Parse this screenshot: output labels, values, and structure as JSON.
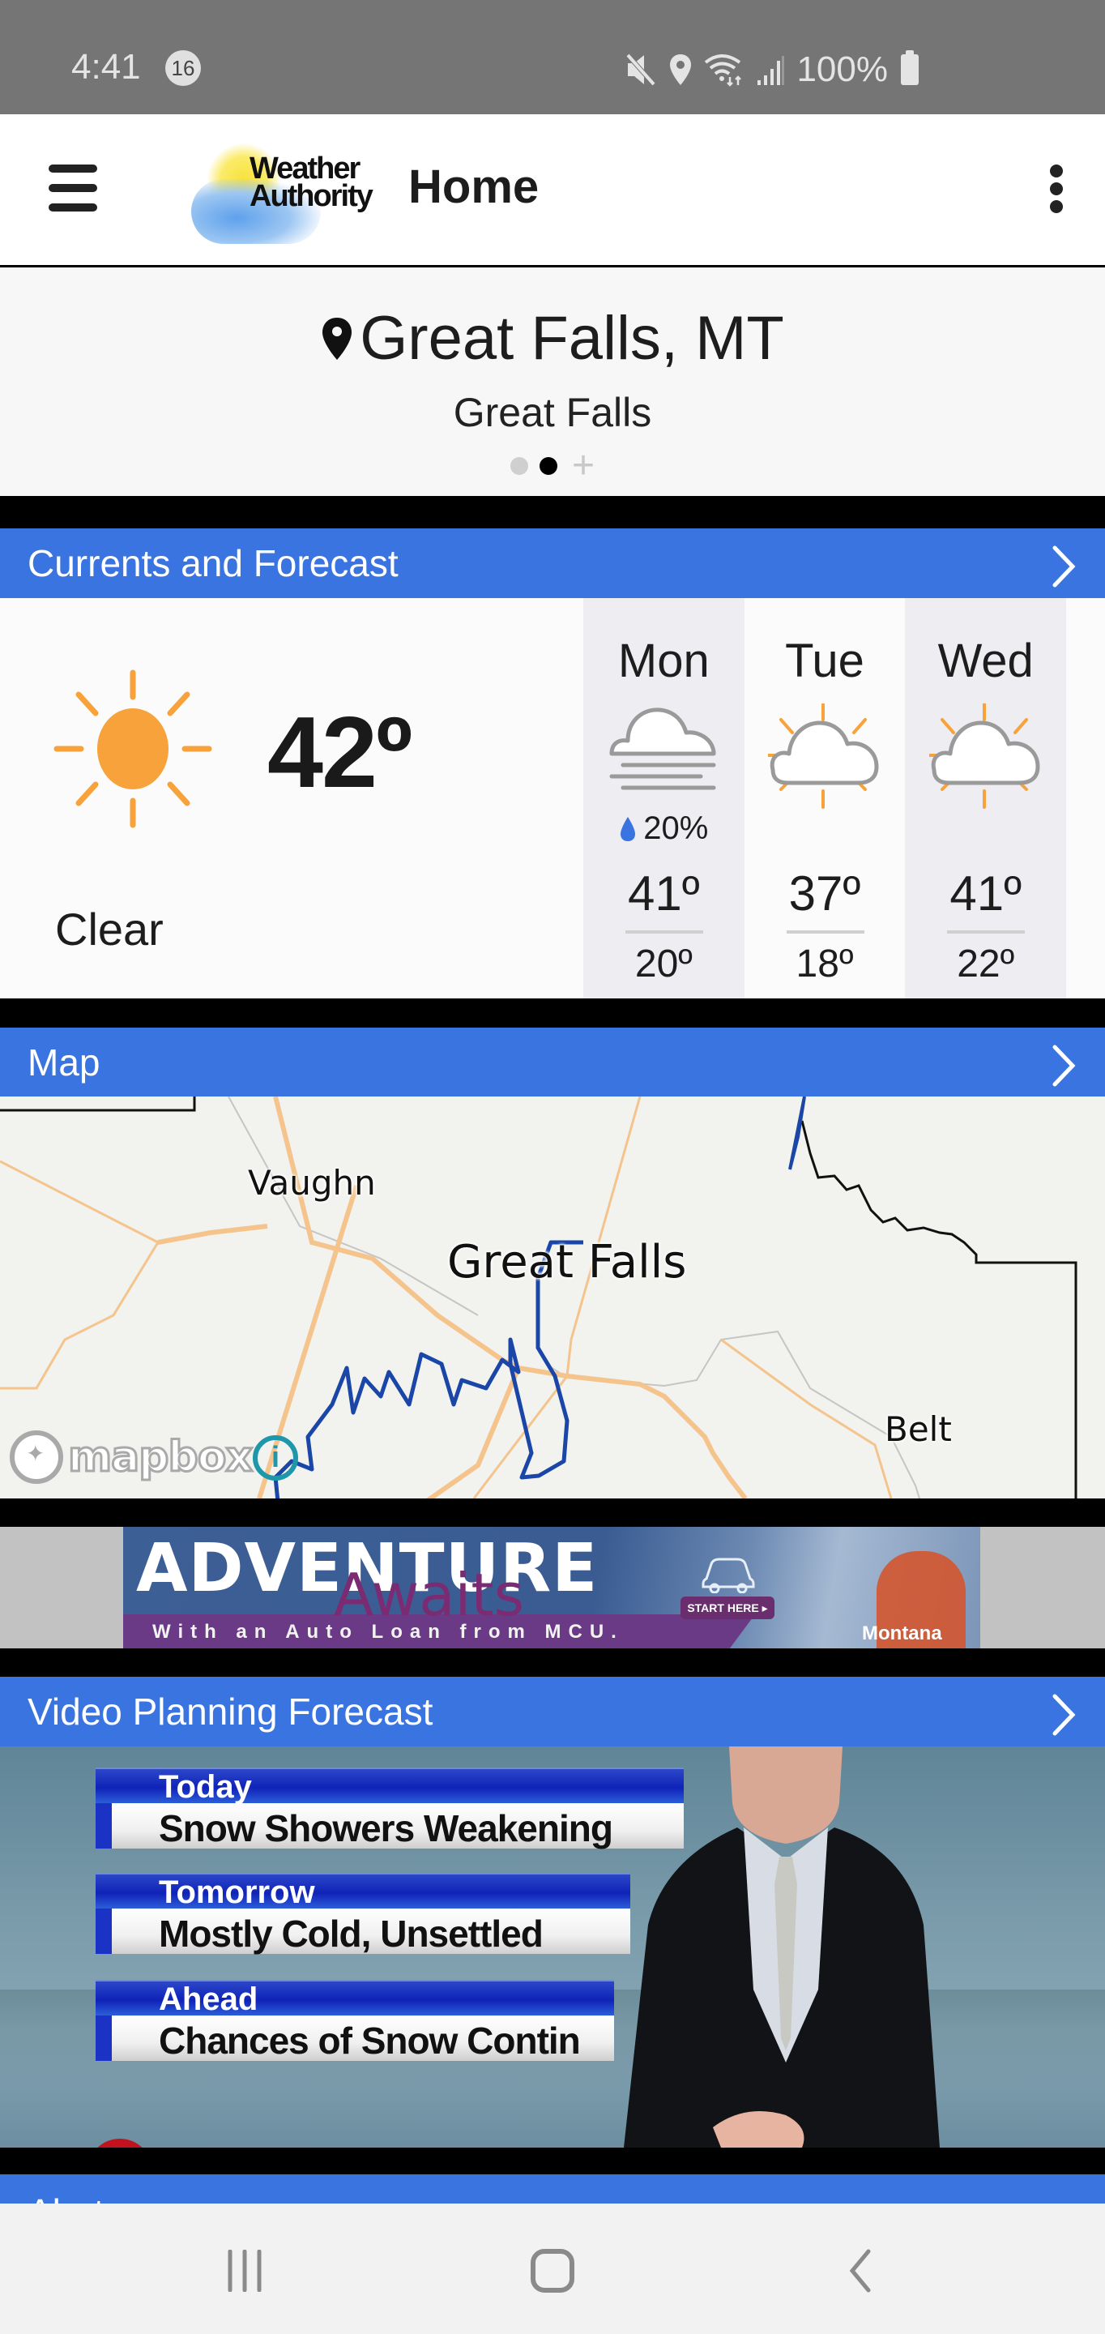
{
  "status_bar": {
    "time": "4:41",
    "notification_count": "16",
    "battery_percent": "100%",
    "icons": [
      "mute-icon",
      "location-icon",
      "wifi-icon",
      "signal-icon",
      "battery-icon"
    ]
  },
  "app_bar": {
    "logo_line1": "Weather",
    "logo_line2": "Authority",
    "title": "Home",
    "menu_icon": "hamburger-menu-icon",
    "overflow_icon": "more-vert-icon"
  },
  "location": {
    "city": "Great Falls, MT",
    "station": "Great Falls",
    "pager": {
      "pages": 2,
      "active_index": 1,
      "add_label": "+"
    }
  },
  "sections": {
    "currents_title": "Currents and Forecast",
    "map_title": "Map",
    "video_title": "Video Planning Forecast",
    "alerts_title": "Alerts"
  },
  "current": {
    "icon": "sun-icon",
    "temperature": "42º",
    "condition": "Clear"
  },
  "forecast": [
    {
      "day": "Mon",
      "icon": "fog-cloud-icon",
      "precip": "20%",
      "high": "41º",
      "low": "20º"
    },
    {
      "day": "Tue",
      "icon": "partly-sunny-icon",
      "precip": "",
      "high": "37º",
      "low": "18º"
    },
    {
      "day": "Wed",
      "icon": "partly-sunny-icon",
      "precip": "",
      "high": "41º",
      "low": "22º"
    }
  ],
  "map": {
    "labels": {
      "vaughn": "Vaughn",
      "great_falls": "Great Falls",
      "belt": "Belt"
    },
    "attribution": "mapbox",
    "info_label": "i"
  },
  "ad": {
    "headline": "ADVENTURE",
    "subheadline": "Awaits",
    "tagline": "With an Auto Loan from MCU.",
    "cta": "START HERE ▸",
    "brand": "Montana"
  },
  "video": {
    "rows": [
      {
        "label": "Today",
        "value": "Snow Showers Weakening"
      },
      {
        "label": "Tomorrow",
        "value": "Mostly Cold, Unsettled"
      },
      {
        "label": "Ahead",
        "value": "Chances of Snow Contin"
      }
    ]
  },
  "colors": {
    "accent": "#3a74e0",
    "sun": "#f7a23a",
    "status_bar": "#757575",
    "precip_drop": "#3a74e0"
  }
}
